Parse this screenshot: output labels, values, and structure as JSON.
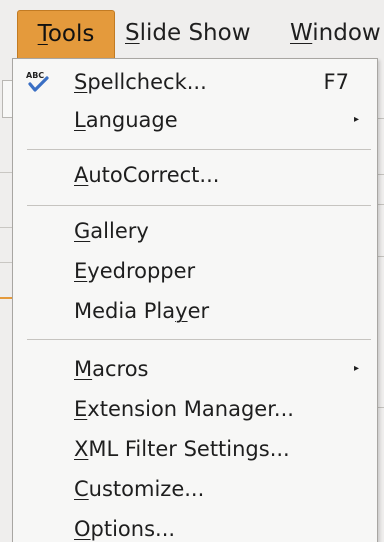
{
  "menubar": {
    "items": [
      {
        "prefix": "",
        "mnemonic": "T",
        "suffix": "ools"
      },
      {
        "prefix": "",
        "mnemonic": "S",
        "suffix": "lide Show"
      },
      {
        "prefix": "",
        "mnemonic": "W",
        "suffix": "indow"
      }
    ]
  },
  "menu": {
    "items": [
      {
        "prefix": "",
        "mnemonic": "S",
        "suffix": "pellcheck...",
        "shortcut": "F7",
        "icon": "spellcheck-icon"
      },
      {
        "prefix": "",
        "mnemonic": "L",
        "suffix": "anguage",
        "submenu": true
      },
      {
        "prefix": "",
        "mnemonic": "A",
        "suffix": "utoCorrect..."
      },
      {
        "prefix": "",
        "mnemonic": "G",
        "suffix": "allery"
      },
      {
        "prefix": "",
        "mnemonic": "E",
        "suffix": "yedropper"
      },
      {
        "prefix": "Media Pla",
        "mnemonic": "y",
        "suffix": "er"
      },
      {
        "prefix": "",
        "mnemonic": "M",
        "suffix": "acros",
        "submenu": true
      },
      {
        "prefix": "",
        "mnemonic": "E",
        "suffix": "xtension Manager..."
      },
      {
        "prefix": "",
        "mnemonic": "X",
        "suffix": "ML Filter Settings..."
      },
      {
        "prefix": "",
        "mnemonic": "C",
        "suffix": "ustomize..."
      },
      {
        "prefix": "",
        "mnemonic": "O",
        "suffix": "ptions..."
      }
    ],
    "icon_text": "ABC",
    "submenu_arrow": "▸"
  },
  "colors": {
    "active_menu": "#e49a3c",
    "menu_bg": "#f7f7f6",
    "check_blue": "#3a6fc4"
  }
}
